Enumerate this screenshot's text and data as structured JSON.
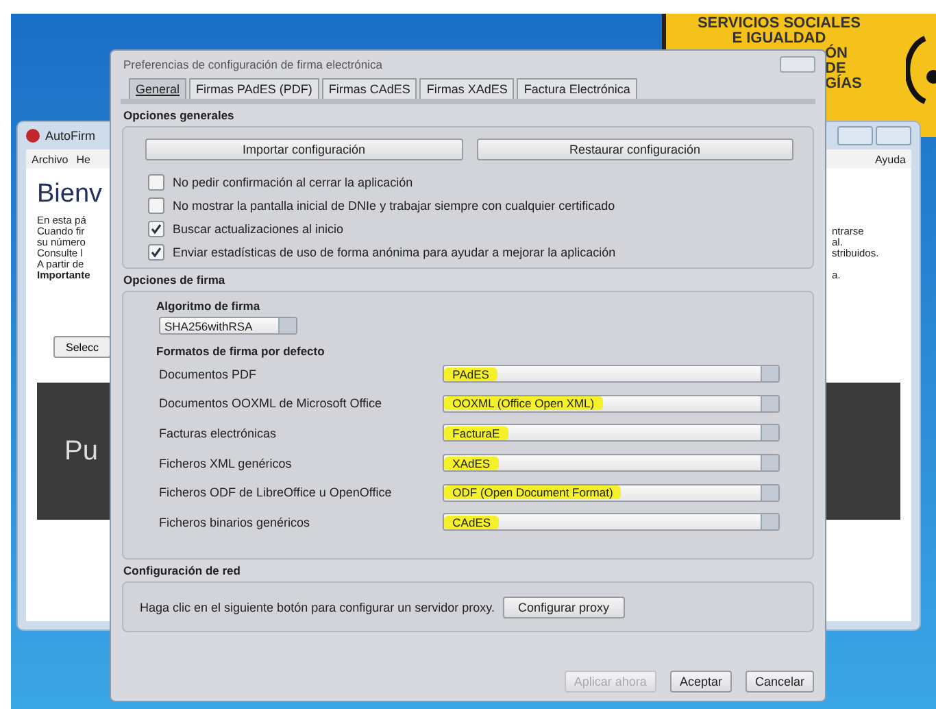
{
  "poster": {
    "lines": [
      "SERVICIOS SOCIALES",
      "E IGUALDAD",
      "ÓN",
      "DE",
      "GÍAS"
    ]
  },
  "background_window": {
    "title": "AutoFirm",
    "menu": [
      "Archivo",
      "He"
    ],
    "help_menu": "Ayuda",
    "heading": "Bienv",
    "left_lines": [
      {
        "text": "En esta pá",
        "bold": false
      },
      {
        "text": "Cuando fir",
        "bold": false
      },
      {
        "text": "su número",
        "bold": false
      },
      {
        "text": "Consulte l",
        "bold": false
      },
      {
        "text": "A partir de",
        "bold": false
      },
      {
        "text": "Importante",
        "bold": true
      }
    ],
    "right_lines": [
      "ntrarse",
      "al.",
      "stribuidos.",
      "a."
    ],
    "button": "Selecc",
    "banner": "Pu"
  },
  "dialog": {
    "title": "Preferencias de configuración de firma electrónica",
    "tabs": [
      {
        "label": "General",
        "selected": true
      },
      {
        "label": "Firmas PAdES (PDF)",
        "selected": false
      },
      {
        "label": "Firmas CAdES",
        "selected": false
      },
      {
        "label": "Firmas XAdES",
        "selected": false
      },
      {
        "label": "Factura Electrónica",
        "selected": false
      }
    ],
    "general": {
      "title": "Opciones generales",
      "buttons": [
        "Importar configuración",
        "Restaurar configuración"
      ],
      "options": [
        {
          "label": "No pedir confirmación al cerrar la aplicación",
          "checked": false
        },
        {
          "label": "No mostrar la pantalla inicial de DNIe y trabajar siempre con cualquier certificado",
          "checked": false
        },
        {
          "label": "Buscar actualizaciones al inicio",
          "checked": true
        },
        {
          "label": "Enviar estadísticas de uso de forma anónima para ayudar a mejorar la aplicación",
          "checked": true
        }
      ]
    },
    "signature": {
      "title": "Opciones de firma",
      "algorithm_label": "Algoritmo de firma",
      "algorithm": "SHA256withRSA",
      "formats_label": "Formatos de firma por defecto",
      "formats": [
        {
          "label": "Documentos PDF",
          "value": "PAdES",
          "highlighted": true
        },
        {
          "label": "Documentos OOXML de Microsoft Office",
          "value": "OOXML (Office Open XML)",
          "highlighted": true
        },
        {
          "label": "Facturas electrónicas",
          "value": "FacturaE",
          "highlighted": true
        },
        {
          "label": "Ficheros XML genéricos",
          "value": "XAdES",
          "highlighted": true
        },
        {
          "label": "Ficheros ODF de LibreOffice u OpenOffice",
          "value": "ODF (Open Document Format)",
          "highlighted": true
        },
        {
          "label": "Ficheros binarios genéricos",
          "value": "CAdES",
          "highlighted": true
        }
      ]
    },
    "network": {
      "title": "Configuración de red",
      "text": "Haga clic en el siguiente botón para configurar un servidor proxy.",
      "button": "Configurar proxy"
    },
    "buttons": [
      {
        "label": "Aplicar ahora",
        "disabled": true
      },
      {
        "label": "Aceptar",
        "disabled": false
      },
      {
        "label": "Cancelar",
        "disabled": false
      }
    ]
  }
}
